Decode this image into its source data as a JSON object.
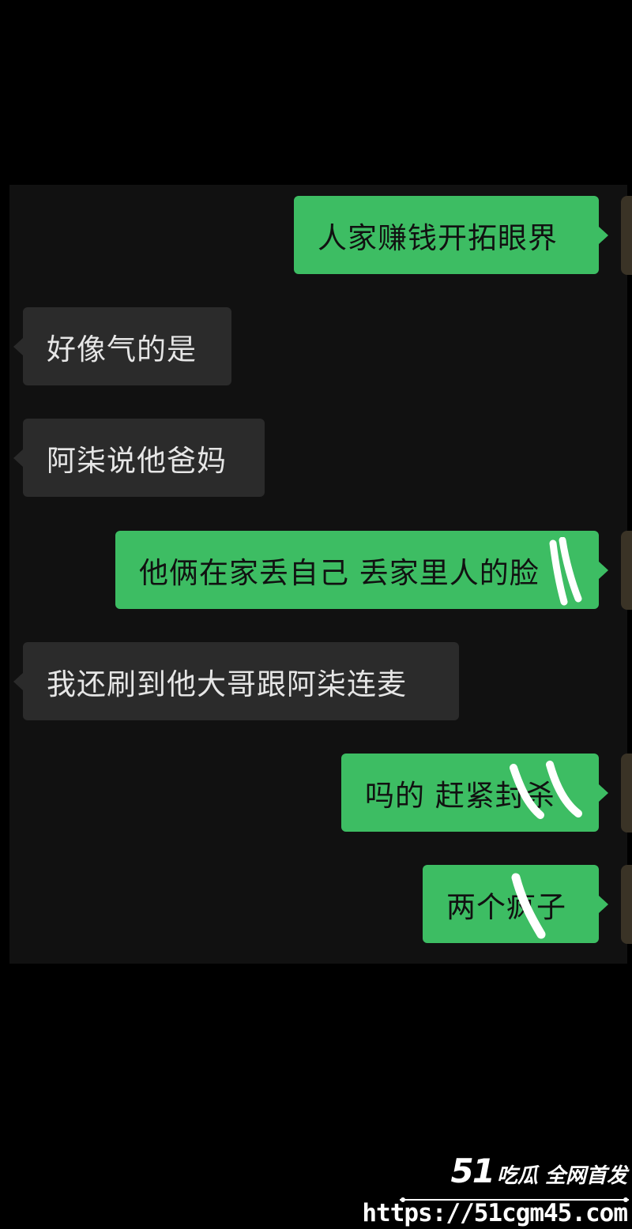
{
  "messages": [
    {
      "side": "out",
      "text": "人家赚钱开拓眼界"
    },
    {
      "side": "in",
      "text": "好像气的是"
    },
    {
      "side": "in",
      "text": "阿柒说他爸妈"
    },
    {
      "side": "out",
      "text": "他俩在家丢自己  丢家里人的脸"
    },
    {
      "side": "in",
      "text": "我还刷到他大哥跟阿柒连麦"
    },
    {
      "side": "out",
      "text": "吗的  赶紧封杀"
    },
    {
      "side": "out",
      "text": "两个疯子"
    }
  ],
  "watermark": {
    "brand_number": "51",
    "brand_text": "吃瓜 全网首发",
    "url": "https://51cgm45.com"
  },
  "colors": {
    "outgoing_bubble": "#3dbd63",
    "incoming_bubble": "#2b2b2b",
    "background": "#000000",
    "chat_panel": "#111111"
  }
}
